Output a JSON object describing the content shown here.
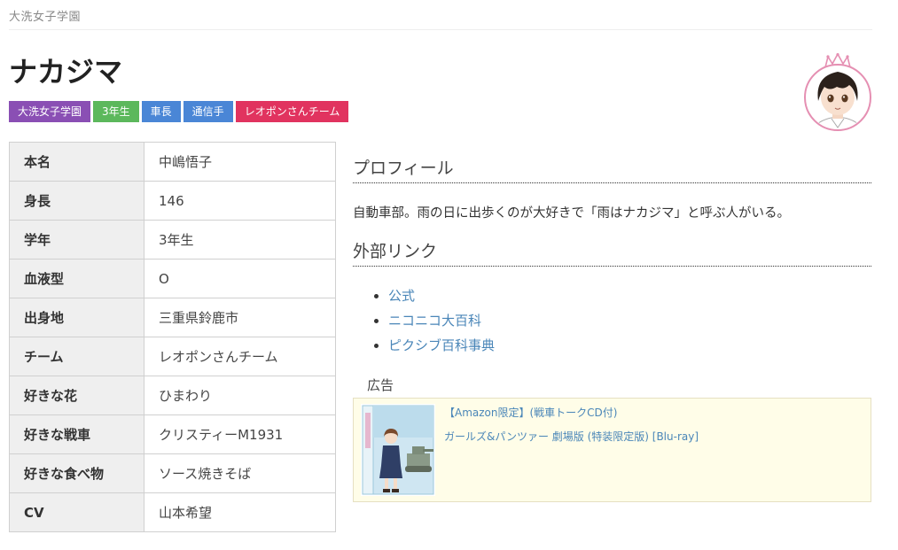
{
  "breadcrumb": {
    "label": "大洗女子学園"
  },
  "character": {
    "name": "ナカジマ"
  },
  "tags": [
    {
      "label": "大洗女子学園",
      "color": "#8a4fb4"
    },
    {
      "label": "3年生",
      "color": "#5cb85c"
    },
    {
      "label": "車長",
      "color": "#4a86d6"
    },
    {
      "label": "通信手",
      "color": "#4a86d6"
    },
    {
      "label": "レオポンさんチーム",
      "color": "#e1335f"
    }
  ],
  "profile_table": [
    {
      "key": "本名",
      "value": "中嶋悟子"
    },
    {
      "key": "身長",
      "value": "146"
    },
    {
      "key": "学年",
      "value": "3年生"
    },
    {
      "key": "血液型",
      "value": "O"
    },
    {
      "key": "出身地",
      "value": "三重県鈴鹿市"
    },
    {
      "key": "チーム",
      "value": "レオポンさんチーム"
    },
    {
      "key": "好きな花",
      "value": "ひまわり"
    },
    {
      "key": "好きな戦車",
      "value": "クリスティーM1931"
    },
    {
      "key": "好きな食べ物",
      "value": "ソース焼きそば"
    },
    {
      "key": "CV",
      "value": "山本希望"
    }
  ],
  "profile": {
    "heading": "プロフィール",
    "text": "自動車部。雨の日に出歩くのが大好きで「雨はナカジマ」と呼ぶ人がいる。"
  },
  "external_links": {
    "heading": "外部リンク",
    "items": [
      "公式",
      "ニコニコ大百科",
      "ピクシブ百科事典"
    ]
  },
  "ad": {
    "label": "広告",
    "line1": "【Amazon限定】(戦車トークCD付)",
    "line2": "ガールズ&パンツァー 劇場版 (特装限定版) [Blu-ray]"
  },
  "colors": {
    "link": "#4a86b8",
    "table_header_bg": "#efefef",
    "ad_bg": "#fffde8"
  }
}
